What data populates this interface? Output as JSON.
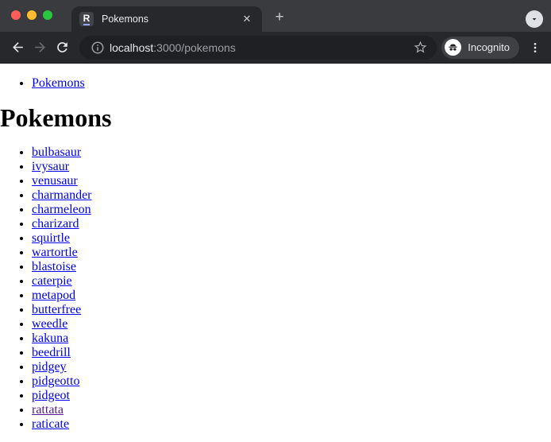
{
  "theme": {
    "frame": "#3A3B3E",
    "tab": "#26282B",
    "omnibox": "#1E2023",
    "pill": "#3E4044",
    "text_light": "#E8EAED",
    "text_dim": "#9AA0A6",
    "link": "#0000EE",
    "visited": "#551A8B",
    "traffic_red": "#FF5F57",
    "traffic_yellow": "#FEBC2E",
    "traffic_green": "#28C840"
  },
  "browser": {
    "tab": {
      "title": "Pokemons",
      "favicon_letter": "R",
      "close_glyph": "✕"
    },
    "new_tab_glyph": "+",
    "address": {
      "host": "localhost",
      "rest": ":3000/pokemons"
    },
    "incognito_label": "Incognito"
  },
  "page": {
    "heading": "Pokemons",
    "nav_links": [
      {
        "name": "Pokemons"
      }
    ],
    "pokemons": [
      {
        "name": "bulbasaur"
      },
      {
        "name": "ivysaur"
      },
      {
        "name": "venusaur"
      },
      {
        "name": "charmander"
      },
      {
        "name": "charmeleon"
      },
      {
        "name": "charizard"
      },
      {
        "name": "squirtle"
      },
      {
        "name": "wartortle"
      },
      {
        "name": "blastoise"
      },
      {
        "name": "caterpie"
      },
      {
        "name": "metapod"
      },
      {
        "name": "butterfree"
      },
      {
        "name": "weedle"
      },
      {
        "name": "kakuna"
      },
      {
        "name": "beedrill"
      },
      {
        "name": "pidgey"
      },
      {
        "name": "pidgeotto"
      },
      {
        "name": "pidgeot"
      },
      {
        "name": "rattata",
        "visited": true
      },
      {
        "name": "raticate"
      }
    ]
  }
}
